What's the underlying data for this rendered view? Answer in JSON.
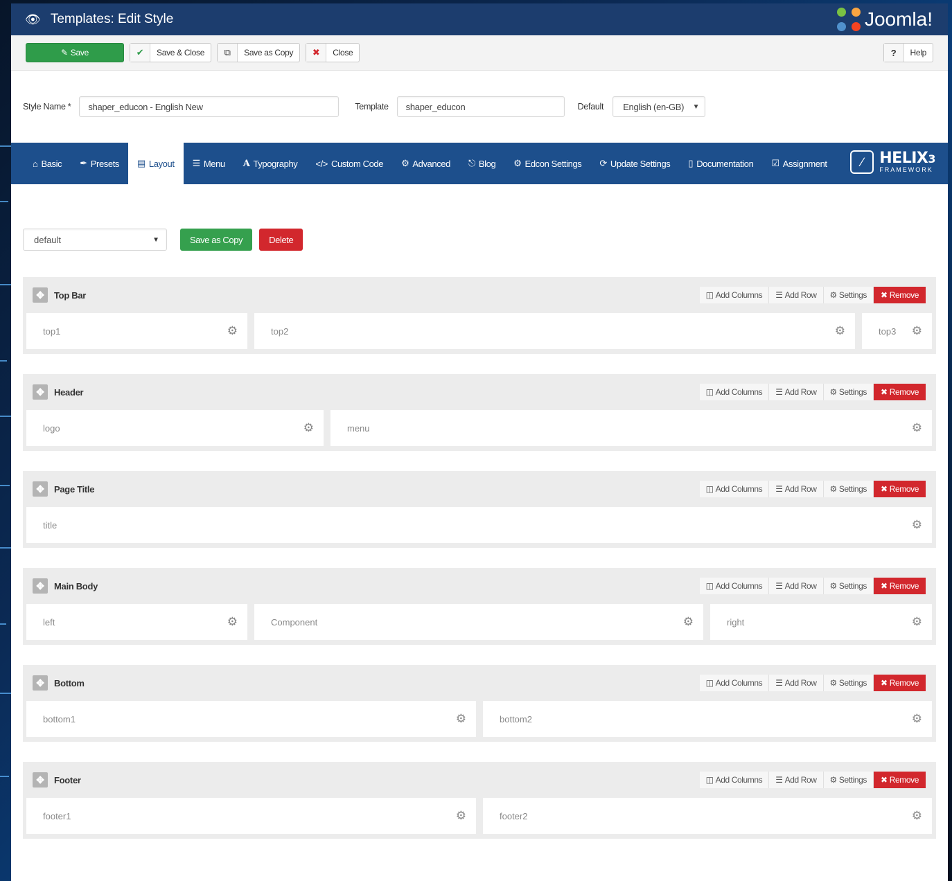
{
  "window": {
    "title": "Templates: Edit Style",
    "brand": "Joomla!"
  },
  "toolbar": {
    "save": "Save",
    "save_close": "Save & Close",
    "save_copy": "Save as Copy",
    "close": "Close",
    "help": "Help"
  },
  "form": {
    "style_name_label": "Style Name *",
    "style_name_value": "shaper_educon - English New",
    "template_label": "Template",
    "template_value": "shaper_educon",
    "default_label": "Default",
    "default_value": "English (en-GB)"
  },
  "nav": {
    "items": [
      {
        "icon": "home-icon",
        "label": "Basic"
      },
      {
        "icon": "brush-icon",
        "label": "Presets"
      },
      {
        "icon": "layout-icon",
        "label": "Layout"
      },
      {
        "icon": "list-icon",
        "label": "Menu"
      },
      {
        "icon": "font-icon",
        "label": "Typography"
      },
      {
        "icon": "code-icon",
        "label": "Custom Code"
      },
      {
        "icon": "cog-icon",
        "label": "Advanced"
      },
      {
        "icon": "pin-icon",
        "label": "Blog"
      },
      {
        "icon": "cogs-icon",
        "label": "Edcon Settings"
      },
      {
        "icon": "refresh-icon",
        "label": "Update Settings"
      },
      {
        "icon": "book-icon",
        "label": "Documentation"
      },
      {
        "icon": "check-square-icon",
        "label": "Assignment"
      }
    ],
    "active": "Layout",
    "helix_title": "HELIX",
    "helix_version": "3",
    "helix_sub": "FRAMEWORK"
  },
  "layout": {
    "select_value": "default",
    "save_copy": "Save as Copy",
    "delete": "Delete",
    "row_actions": {
      "add_columns": "Add Columns",
      "add_row": "Add Row",
      "settings": "Settings",
      "remove": "Remove"
    },
    "sections": [
      {
        "title": "Top Bar",
        "columns": [
          "top1",
          "top2",
          "top3"
        ]
      },
      {
        "title": "Header",
        "columns": [
          "logo",
          "menu"
        ]
      },
      {
        "title": "Page Title",
        "columns": [
          "title"
        ]
      },
      {
        "title": "Main Body",
        "columns": [
          "left",
          "Component",
          "right"
        ]
      },
      {
        "title": "Bottom",
        "columns": [
          "bottom1",
          "bottom2"
        ]
      },
      {
        "title": "Footer",
        "columns": [
          "footer1",
          "footer2"
        ]
      }
    ]
  },
  "colors": {
    "titlebar": "#1c3d6e",
    "nav": "#1d4f8c",
    "save": "#2f9c4a",
    "remove": "#d2272d"
  }
}
